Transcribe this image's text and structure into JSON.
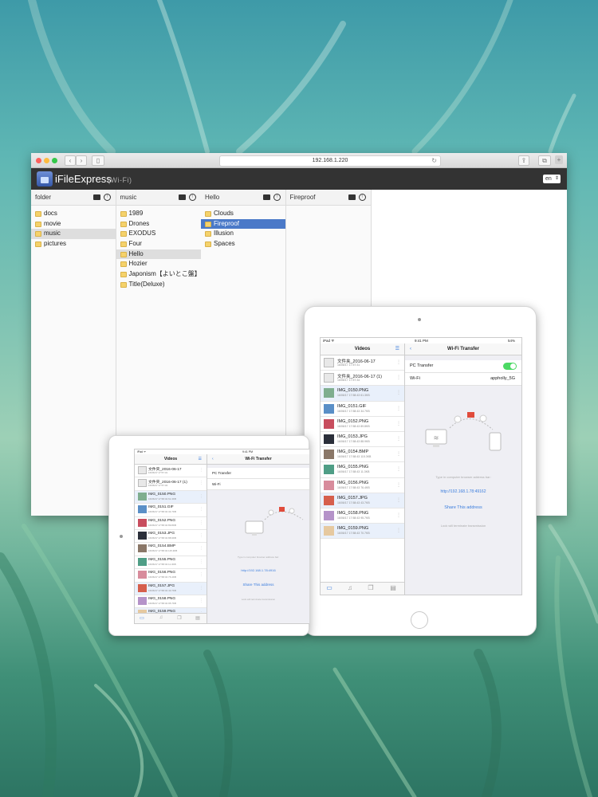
{
  "browser": {
    "url": "192.168.1.220",
    "app_title": "iFileExpress",
    "app_subtitle": "(Wi-Fi)",
    "language": "en",
    "columns": [
      {
        "title": "folder",
        "items": [
          "docs",
          "movie",
          "music",
          "pictures"
        ],
        "selected": "music",
        "selected_style": "grey"
      },
      {
        "title": "music",
        "items": [
          "1989",
          "Drones",
          "EXODUS",
          "Four",
          "Hello",
          "Hozier",
          "Japonism【よいとこ盤】",
          "Title(Deluxe)"
        ],
        "selected": "Hello",
        "selected_style": "grey"
      },
      {
        "title": "Hello",
        "items": [
          "Clouds",
          "Fireproof",
          "Illusion",
          "Spaces"
        ],
        "selected": "Fireproof",
        "selected_style": "blue"
      },
      {
        "title": "Fireproof",
        "items": []
      }
    ]
  },
  "tablet_large": {
    "status_left": "iPad ᯤ",
    "status_time": "9:41 PM",
    "status_battery": "54%",
    "list_title": "Videos",
    "right_title": "Wi-Fi Transfer",
    "settings": [
      {
        "label": "PC Transfer",
        "value": ""
      },
      {
        "label": "Wi-Fi",
        "value": "appholly_5G"
      }
    ],
    "help_text": "Type in computer browser address bar:",
    "address": "http://192.168.1.78:49162",
    "share_label": "Share This address",
    "footer_text": "Lock will terminate transmission",
    "files": [
      {
        "name": "文件夹_2016-06-17",
        "meta": "16/06/17 17:57:31",
        "kind": "folder",
        "color": "#e8e8e8"
      },
      {
        "name": "文件夹_2016-06-17 (1)",
        "meta": "16/06/17 17:57:34",
        "kind": "folder",
        "color": "#e8e8e8"
      },
      {
        "name": "IMG_0150.PNG",
        "meta": "16/06/17 17:58:43  61.3KB",
        "kind": "image",
        "color": "#7fae8f"
      },
      {
        "name": "IMG_0151.GIF",
        "meta": "16/06/17 17:58:43  34.7KB",
        "kind": "image",
        "color": "#5a8fc7"
      },
      {
        "name": "IMG_0152.PNG",
        "meta": "16/06/17 17:58:43  89.8KB",
        "kind": "image",
        "color": "#c84d5e"
      },
      {
        "name": "IMG_0153.JPG",
        "meta": "16/06/17 17:58:43  88.9KB",
        "kind": "image",
        "color": "#2b2f3a"
      },
      {
        "name": "IMG_0154.BMP",
        "meta": "16/06/17 17:58:43  115.3KB",
        "kind": "image",
        "color": "#8a7768"
      },
      {
        "name": "IMG_0155.PNG",
        "meta": "16/06/17 17:58:43  11.3KB",
        "kind": "image",
        "color": "#4f9e86"
      },
      {
        "name": "IMG_0156.PNG",
        "meta": "16/06/17 17:58:43  76.4KB",
        "kind": "image",
        "color": "#d88c9c"
      },
      {
        "name": "IMG_0157.JPG",
        "meta": "16/06/17 17:58:43  43.7KB",
        "kind": "image",
        "color": "#d65f4c"
      },
      {
        "name": "IMG_0158.PNG",
        "meta": "16/06/17 17:58:43  95.7KB",
        "kind": "image",
        "color": "#b593c9"
      },
      {
        "name": "IMG_0159.PNG",
        "meta": "16/06/17 17:58:43  70.7KB",
        "kind": "image",
        "color": "#e6c9a0"
      }
    ]
  },
  "tablet_small": {
    "status_left": "iPad ᯤ",
    "status_time": "9:41 PM",
    "list_title": "Videos",
    "right_title": "Wi-Fi Transfer",
    "settings": [
      {
        "label": "PC Transfer"
      },
      {
        "label": "Wi-Fi"
      }
    ],
    "help_text": "Type in computer browser address bar:",
    "address": "http://192.168.1.78:4916",
    "share_label": "Share This address",
    "footer_text": "Lock will terminate transmission",
    "files": [
      {
        "name": "文件夹_2016-06-17",
        "meta": "16/06/17 17:57:31",
        "kind": "folder",
        "color": "#e8e8e8"
      },
      {
        "name": "文件夹_2016-06-17 (1)",
        "meta": "16/06/17 17:57:34",
        "kind": "folder",
        "color": "#e8e8e8"
      },
      {
        "name": "IMG_0150.PNG",
        "meta": "16/06/17 17:58:43  61.3KB",
        "kind": "image",
        "color": "#7fae8f"
      },
      {
        "name": "IMG_0151.GIF",
        "meta": "16/06/17 17:58:43  34.7KB",
        "kind": "image",
        "color": "#5a8fc7"
      },
      {
        "name": "IMG_0152.PNG",
        "meta": "16/06/17 17:58:43  89.8KB",
        "kind": "image",
        "color": "#c84d5e"
      },
      {
        "name": "IMG_0153.JPG",
        "meta": "16/06/17 17:58:43  88.9KB",
        "kind": "image",
        "color": "#2b2f3a"
      },
      {
        "name": "IMG_0154.BMP",
        "meta": "16/06/17 17:58:43  115.3KB",
        "kind": "image",
        "color": "#8a7768"
      },
      {
        "name": "IMG_0155.PNG",
        "meta": "16/06/17 17:58:43  11.3KB",
        "kind": "image",
        "color": "#4f9e86"
      },
      {
        "name": "IMG_0156.PNG",
        "meta": "16/06/17 17:58:43  76.4KB",
        "kind": "image",
        "color": "#d88c9c"
      },
      {
        "name": "IMG_0157.JPG",
        "meta": "16/06/17 17:58:43  43.7KB",
        "kind": "image",
        "color": "#d65f4c"
      },
      {
        "name": "IMG_0158.PNG",
        "meta": "16/06/17 17:58:43  95.7KB",
        "kind": "image",
        "color": "#b593c9"
      },
      {
        "name": "IMG_0159.PNG",
        "meta": "16/06/17 17:58:43  70.7KB",
        "kind": "image",
        "color": "#e6c9a0"
      }
    ]
  },
  "colors": {
    "toggle_on": "#4cd964",
    "link": "#3b7ddd",
    "selection_blue": "#4a79c8",
    "header_dark": "#333333"
  },
  "icons": [
    "folder-icon",
    "upload-icon",
    "menu-icon",
    "back-chevron-icon",
    "video-tab-icon",
    "music-tab-icon",
    "files-tab-icon",
    "document-tab-icon",
    "computer-icon",
    "phone-icon"
  ]
}
